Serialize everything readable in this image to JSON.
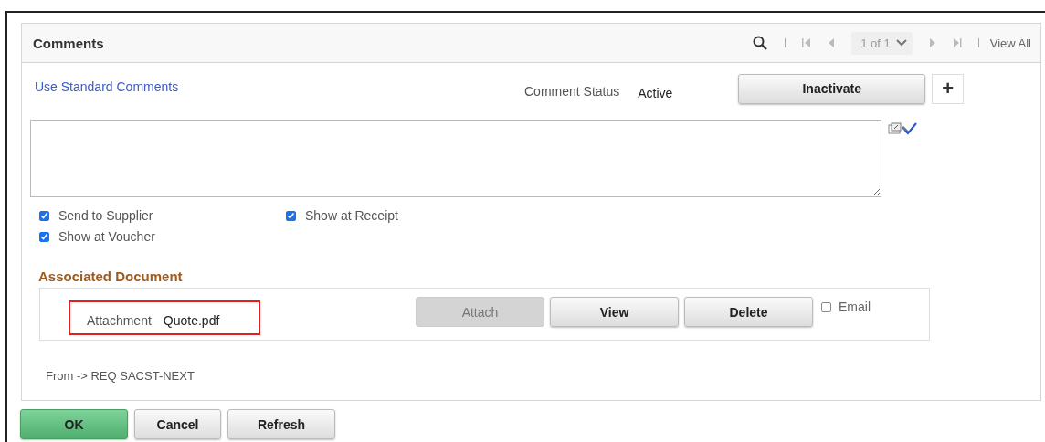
{
  "panel": {
    "title": "Comments",
    "pager": {
      "position": "1 of 1",
      "view_all": "View All"
    }
  },
  "standard_comments_link": "Use Standard Comments",
  "status": {
    "label": "Comment Status",
    "value": "Active"
  },
  "inactivate_button": "Inactivate",
  "add_button": "+",
  "checkboxes": [
    {
      "label": "Send to Supplier",
      "checked": true
    },
    {
      "label": "Show at Receipt",
      "checked": true
    },
    {
      "label": "Show at Voucher",
      "checked": true
    }
  ],
  "associated_document": {
    "title": "Associated Document",
    "attachment_label": "Attachment",
    "attachment_value": "Quote.pdf",
    "highlighted": true,
    "buttons": [
      {
        "label": "Attach",
        "disabled": true
      },
      {
        "label": "View",
        "disabled": false
      },
      {
        "label": "Delete",
        "disabled": false
      }
    ],
    "email": {
      "label": "Email",
      "checked": false
    }
  },
  "source_note": "From -> REQ SACST-NEXT",
  "footer_buttons": [
    {
      "label": "OK",
      "kind": "primary"
    },
    {
      "label": "Cancel",
      "kind": "normal"
    },
    {
      "label": "Refresh",
      "kind": "normal"
    }
  ]
}
